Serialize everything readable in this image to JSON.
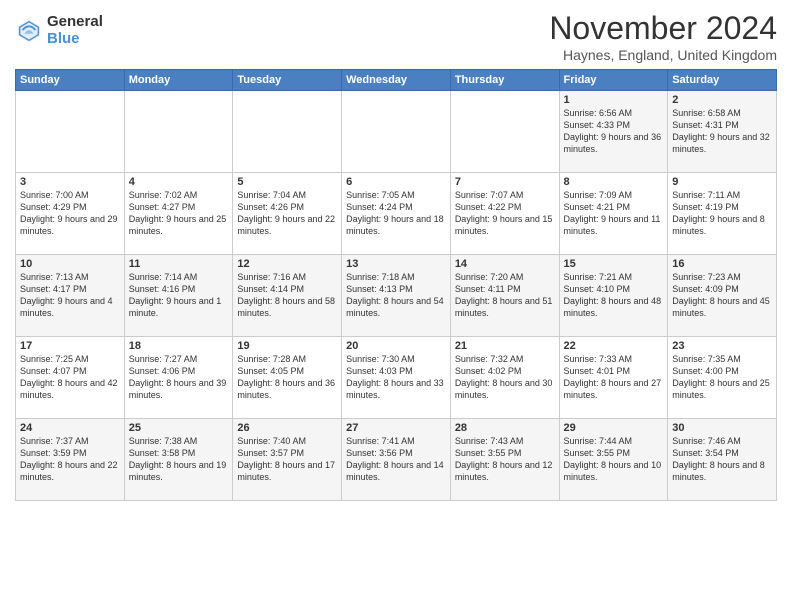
{
  "logo": {
    "general": "General",
    "blue": "Blue"
  },
  "header": {
    "month": "November 2024",
    "location": "Haynes, England, United Kingdom"
  },
  "weekdays": [
    "Sunday",
    "Monday",
    "Tuesday",
    "Wednesday",
    "Thursday",
    "Friday",
    "Saturday"
  ],
  "weeks": [
    [
      {
        "day": "",
        "info": ""
      },
      {
        "day": "",
        "info": ""
      },
      {
        "day": "",
        "info": ""
      },
      {
        "day": "",
        "info": ""
      },
      {
        "day": "",
        "info": ""
      },
      {
        "day": "1",
        "info": "Sunrise: 6:56 AM\nSunset: 4:33 PM\nDaylight: 9 hours and 36 minutes."
      },
      {
        "day": "2",
        "info": "Sunrise: 6:58 AM\nSunset: 4:31 PM\nDaylight: 9 hours and 32 minutes."
      }
    ],
    [
      {
        "day": "3",
        "info": "Sunrise: 7:00 AM\nSunset: 4:29 PM\nDaylight: 9 hours and 29 minutes."
      },
      {
        "day": "4",
        "info": "Sunrise: 7:02 AM\nSunset: 4:27 PM\nDaylight: 9 hours and 25 minutes."
      },
      {
        "day": "5",
        "info": "Sunrise: 7:04 AM\nSunset: 4:26 PM\nDaylight: 9 hours and 22 minutes."
      },
      {
        "day": "6",
        "info": "Sunrise: 7:05 AM\nSunset: 4:24 PM\nDaylight: 9 hours and 18 minutes."
      },
      {
        "day": "7",
        "info": "Sunrise: 7:07 AM\nSunset: 4:22 PM\nDaylight: 9 hours and 15 minutes."
      },
      {
        "day": "8",
        "info": "Sunrise: 7:09 AM\nSunset: 4:21 PM\nDaylight: 9 hours and 11 minutes."
      },
      {
        "day": "9",
        "info": "Sunrise: 7:11 AM\nSunset: 4:19 PM\nDaylight: 9 hours and 8 minutes."
      }
    ],
    [
      {
        "day": "10",
        "info": "Sunrise: 7:13 AM\nSunset: 4:17 PM\nDaylight: 9 hours and 4 minutes."
      },
      {
        "day": "11",
        "info": "Sunrise: 7:14 AM\nSunset: 4:16 PM\nDaylight: 9 hours and 1 minute."
      },
      {
        "day": "12",
        "info": "Sunrise: 7:16 AM\nSunset: 4:14 PM\nDaylight: 8 hours and 58 minutes."
      },
      {
        "day": "13",
        "info": "Sunrise: 7:18 AM\nSunset: 4:13 PM\nDaylight: 8 hours and 54 minutes."
      },
      {
        "day": "14",
        "info": "Sunrise: 7:20 AM\nSunset: 4:11 PM\nDaylight: 8 hours and 51 minutes."
      },
      {
        "day": "15",
        "info": "Sunrise: 7:21 AM\nSunset: 4:10 PM\nDaylight: 8 hours and 48 minutes."
      },
      {
        "day": "16",
        "info": "Sunrise: 7:23 AM\nSunset: 4:09 PM\nDaylight: 8 hours and 45 minutes."
      }
    ],
    [
      {
        "day": "17",
        "info": "Sunrise: 7:25 AM\nSunset: 4:07 PM\nDaylight: 8 hours and 42 minutes."
      },
      {
        "day": "18",
        "info": "Sunrise: 7:27 AM\nSunset: 4:06 PM\nDaylight: 8 hours and 39 minutes."
      },
      {
        "day": "19",
        "info": "Sunrise: 7:28 AM\nSunset: 4:05 PM\nDaylight: 8 hours and 36 minutes."
      },
      {
        "day": "20",
        "info": "Sunrise: 7:30 AM\nSunset: 4:03 PM\nDaylight: 8 hours and 33 minutes."
      },
      {
        "day": "21",
        "info": "Sunrise: 7:32 AM\nSunset: 4:02 PM\nDaylight: 8 hours and 30 minutes."
      },
      {
        "day": "22",
        "info": "Sunrise: 7:33 AM\nSunset: 4:01 PM\nDaylight: 8 hours and 27 minutes."
      },
      {
        "day": "23",
        "info": "Sunrise: 7:35 AM\nSunset: 4:00 PM\nDaylight: 8 hours and 25 minutes."
      }
    ],
    [
      {
        "day": "24",
        "info": "Sunrise: 7:37 AM\nSunset: 3:59 PM\nDaylight: 8 hours and 22 minutes."
      },
      {
        "day": "25",
        "info": "Sunrise: 7:38 AM\nSunset: 3:58 PM\nDaylight: 8 hours and 19 minutes."
      },
      {
        "day": "26",
        "info": "Sunrise: 7:40 AM\nSunset: 3:57 PM\nDaylight: 8 hours and 17 minutes."
      },
      {
        "day": "27",
        "info": "Sunrise: 7:41 AM\nSunset: 3:56 PM\nDaylight: 8 hours and 14 minutes."
      },
      {
        "day": "28",
        "info": "Sunrise: 7:43 AM\nSunset: 3:55 PM\nDaylight: 8 hours and 12 minutes."
      },
      {
        "day": "29",
        "info": "Sunrise: 7:44 AM\nSunset: 3:55 PM\nDaylight: 8 hours and 10 minutes."
      },
      {
        "day": "30",
        "info": "Sunrise: 7:46 AM\nSunset: 3:54 PM\nDaylight: 8 hours and 8 minutes."
      }
    ]
  ]
}
